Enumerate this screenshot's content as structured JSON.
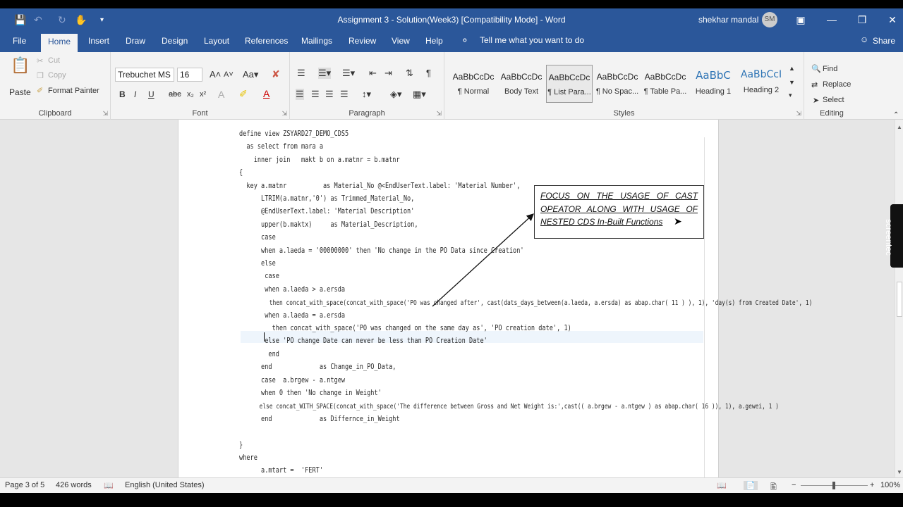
{
  "window": {
    "title": "Assignment 3 - Solution(Week3) [Compatibility Mode]  -  Word",
    "user_name": "shekhar mandal",
    "user_initials": "SM",
    "share": "Share",
    "tell_me": "Tell me what you want to do"
  },
  "tabs": [
    "File",
    "Home",
    "Insert",
    "Draw",
    "Design",
    "Layout",
    "References",
    "Mailings",
    "Review",
    "View",
    "Help"
  ],
  "ribbon": {
    "clipboard": {
      "label": "Clipboard",
      "paste": "Paste",
      "cut": "Cut",
      "copy": "Copy",
      "format_painter": "Format Painter"
    },
    "font": {
      "label": "Font",
      "family": "Trebuchet MS",
      "size": "16"
    },
    "paragraph": {
      "label": "Paragraph"
    },
    "styles": {
      "label": "Styles",
      "items": [
        {
          "preview": "AaBbCcDc",
          "name": "¶ Normal"
        },
        {
          "preview": "AaBbCcDc",
          "name": "Body Text"
        },
        {
          "preview": "AaBbCcDc",
          "name": "¶ List Para..."
        },
        {
          "preview": "AaBbCcDc",
          "name": "¶ No Spac..."
        },
        {
          "preview": "AaBbCcDc",
          "name": "¶ Table Pa..."
        },
        {
          "preview": "AaBbC",
          "name": "Heading 1"
        },
        {
          "preview": "AaBbCcI",
          "name": "Heading 2"
        }
      ]
    },
    "editing": {
      "label": "Editing",
      "find": "Find",
      "replace": "Replace",
      "select": "Select"
    }
  },
  "document": {
    "code_lines": [
      "define view ZSYARD27_DEMO_CDS5",
      "  as select from mara a",
      "    inner join   makt b on a.matnr = b.matnr",
      "{",
      "  key a.matnr          as Material_No @<EndUserText.label: 'Material Number',",
      "      LTRIM(a.matnr,'0') as Trimmed_Material_No,",
      "      @EndUserText.label: 'Material Description'",
      "      upper(b.maktx)     as Material_Description,",
      "      case",
      "      when a.laeda = '00000000' then 'No change in the PO Data since Creation'",
      "      else",
      "       case",
      "       when a.laeda > a.ersda",
      "         then concat_with_space(concat_with_space('PO was changed after', cast(dats_days_between(a.laeda, a.ersda) as abap.char( 11 ) ), 1), 'day(s) from Created Date', 1)",
      "       when a.laeda = a.ersda",
      "         then concat_with_space('PO was changed on the same day as', 'PO creation date', 1)",
      "       else 'PO change Date can never be less than PO Creation Date'",
      "        end",
      "      end             as Change_in_PO_Data,",
      "      case  a.brgew - a.ntgew",
      "      when 0 then 'No change in Weight'",
      "      else concat_WITH_SPACE(concat_with_space('The difference between Gross and Net Weight is:',cast(( a.brgew - a.ntgew ) as abap.char( 16 )), 1), a.gewei, 1 )",
      "      end             as Differnce_in_Weight",
      "",
      "}",
      "where",
      "      a.mtart =  'FERT'"
    ],
    "callout": "FOCUS ON THE USAGE OF CAST OPEATOR ALONG WITH USAGE OF NESTED CDS In-Built Functions"
  },
  "status": {
    "page": "Page 3 of 5",
    "words": "426 words",
    "language": "English (United States)",
    "zoom": "100%"
  },
  "recorder": "screentec"
}
